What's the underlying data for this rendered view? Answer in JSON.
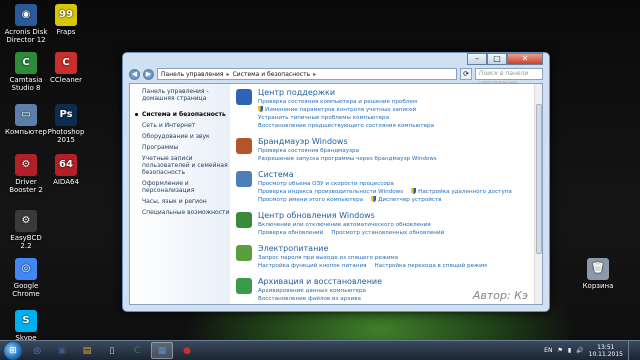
{
  "desktop": {
    "icons": [
      {
        "label": "Acronis Disk Director 12",
        "color": "#2a5a9a",
        "glyph": "◉"
      },
      {
        "label": "Fraps",
        "color": "#d8c600",
        "glyph": "99"
      },
      {
        "label": "Camtasia Studio 8",
        "color": "#2e8b3c",
        "glyph": "C"
      },
      {
        "label": "CCleaner",
        "color": "#c9302c",
        "glyph": "C"
      },
      {
        "label": "Компьютер",
        "color": "#5b7fa8",
        "glyph": "▭"
      },
      {
        "label": "Photoshop 2015",
        "color": "#0c2d4d",
        "glyph": "Ps"
      },
      {
        "label": "Driver Booster 2",
        "color": "#b3202a",
        "glyph": "⚙"
      },
      {
        "label": "AIDA64",
        "color": "#b3202a",
        "glyph": "64"
      },
      {
        "label": "EasyBCD 2.2",
        "color": "#3a3a3a",
        "glyph": "⚙"
      },
      {
        "label": "Google Chrome",
        "color": "#4285f4",
        "glyph": "◎"
      },
      {
        "label": "Skype",
        "color": "#00aff0",
        "glyph": "S"
      },
      {
        "label": "Корзина",
        "color": "#8a9aaa",
        "glyph": "🗑"
      }
    ]
  },
  "window": {
    "buttons": {
      "minimize": "–",
      "maximize": "□",
      "close": "✕"
    },
    "nav": {
      "back": "◀",
      "forward": "▶",
      "refresh": "⟳"
    },
    "breadcrumb": [
      "Панель управления",
      "Система и безопасность"
    ],
    "search_placeholder": "Поиск в панели управления",
    "sidebar": {
      "home": "Панель управления - домашняя страница",
      "items": [
        "Система и безопасность",
        "Сеть и Интернет",
        "Оборудование и звук",
        "Программы",
        "Учетные записи пользователей и семейная безопасность",
        "Оформление и персонализация",
        "Часы, язык и регион",
        "Специальные возможности"
      ]
    },
    "categories": [
      {
        "title": "Центр поддержки",
        "icon_color": "#2f63b8",
        "links": [
          {
            "text": "Проверка состояния компьютера и решение проблем",
            "shield": false
          },
          {
            "text": "Изменение параметров контроля учетных записей",
            "shield": true
          },
          {
            "text": "Устранить типичные проблемы компьютера",
            "shield": false
          },
          {
            "text": "Восстановление предшествующего состояния компьютера",
            "shield": false
          }
        ]
      },
      {
        "title": "Брандмауэр Windows",
        "icon_color": "#b5532a",
        "links": [
          {
            "text": "Проверка состояния брандмауэра",
            "shield": false
          },
          {
            "text": "Разрешение запуска программы через брандмауэр Windows",
            "shield": false
          }
        ]
      },
      {
        "title": "Система",
        "icon_color": "#4a7fb8",
        "links": [
          {
            "text": "Просмотр объема ОЗУ и скорости процессора",
            "shield": false
          },
          {
            "text": "Проверка индекса производительности Windows",
            "shield": false
          },
          {
            "text": "Настройка удаленного доступа",
            "shield": true
          },
          {
            "text": "Просмотр имени этого компьютера",
            "shield": false
          },
          {
            "text": "Диспетчер устройств",
            "shield": true
          }
        ]
      },
      {
        "title": "Центр обновления Windows",
        "icon_color": "#3b8a3b",
        "links": [
          {
            "text": "Включение или отключение автоматического обновления",
            "shield": false
          },
          {
            "text": "Проверка обновлений",
            "shield": false
          },
          {
            "text": "Просмотр установленных обновлений",
            "shield": false
          }
        ]
      },
      {
        "title": "Электропитание",
        "icon_color": "#5aa03a",
        "links": [
          {
            "text": "Запрос пароля при выходе из спящего режима",
            "shield": false
          },
          {
            "text": "Настройка функций кнопок питания",
            "shield": false
          },
          {
            "text": "Настройка перехода в спящий режим",
            "shield": false
          }
        ]
      },
      {
        "title": "Архивация и восстановление",
        "icon_color": "#3a9a4a",
        "links": [
          {
            "text": "Архивирование данных компьютера",
            "shield": false
          },
          {
            "text": "Восстановление файлов из архива",
            "shield": false
          }
        ]
      }
    ],
    "watermark": "Автор: Кэ"
  },
  "taskbar": {
    "start_glyph": "⊞",
    "items": [
      {
        "name": "chrome",
        "color": "#4285f4",
        "glyph": "◎",
        "active": false
      },
      {
        "name": "save",
        "color": "#3a5a8a",
        "glyph": "▣",
        "active": false
      },
      {
        "name": "explorer",
        "color": "#d9a93a",
        "glyph": "▤",
        "active": false
      },
      {
        "name": "document",
        "color": "#d0d0d0",
        "glyph": "▯",
        "active": false
      },
      {
        "name": "camtasia",
        "color": "#2e8b3c",
        "glyph": "C",
        "active": false
      },
      {
        "name": "control-panel",
        "color": "#5b8bd0",
        "glyph": "▦",
        "active": true
      },
      {
        "name": "recording",
        "color": "#c9302c",
        "glyph": "●",
        "active": false
      }
    ],
    "language": "EN",
    "time": "13:51",
    "date": "10.11.2015"
  }
}
